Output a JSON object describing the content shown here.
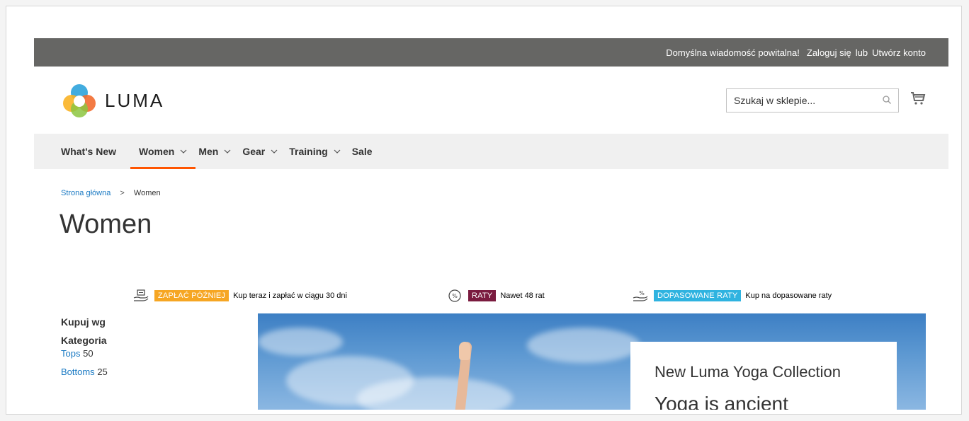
{
  "topbar": {
    "welcome": "Domyślna wiadomość powitalna!",
    "signin": "Zaloguj się",
    "or": "lub",
    "create": "Utwórz konto"
  },
  "header": {
    "logo_text": "LUMA",
    "search_placeholder": "Szukaj w sklepie...",
    "cart_icon": "shopping-cart-icon"
  },
  "nav": [
    {
      "label": "What's New",
      "dropdown": false
    },
    {
      "label": "Women",
      "dropdown": true,
      "active": true
    },
    {
      "label": "Men",
      "dropdown": true
    },
    {
      "label": "Gear",
      "dropdown": true
    },
    {
      "label": "Training",
      "dropdown": true
    },
    {
      "label": "Sale",
      "dropdown": false
    }
  ],
  "breadcrumb": {
    "home": "Strona główna",
    "sep": ">",
    "current": "Women"
  },
  "page_title": "Women",
  "promos": [
    {
      "badge": "ZAPŁAĆ PÓŹNIEJ",
      "badge_color": "#f6a623",
      "text": "Kup teraz i zapłać w ciągu 30 dni"
    },
    {
      "badge": "RATY",
      "badge_color": "#7a1b3f",
      "text": "Nawet 48 rat"
    },
    {
      "badge": "DOPASOWANE RATY",
      "badge_color": "#2fb3e0",
      "text": "Kup na dopasowane raty"
    }
  ],
  "sidebar": {
    "heading": "Kupuj wg",
    "category_title": "Kategoria",
    "items": [
      {
        "label": "Tops",
        "count": "50"
      },
      {
        "label": "Bottoms",
        "count": "25"
      }
    ]
  },
  "hero": {
    "title": "New Luma Yoga Collection",
    "subtitle": "Yoga is ancient"
  },
  "colors": {
    "accent": "#ff5501",
    "link": "#1979c3",
    "topbar": "#666664"
  }
}
